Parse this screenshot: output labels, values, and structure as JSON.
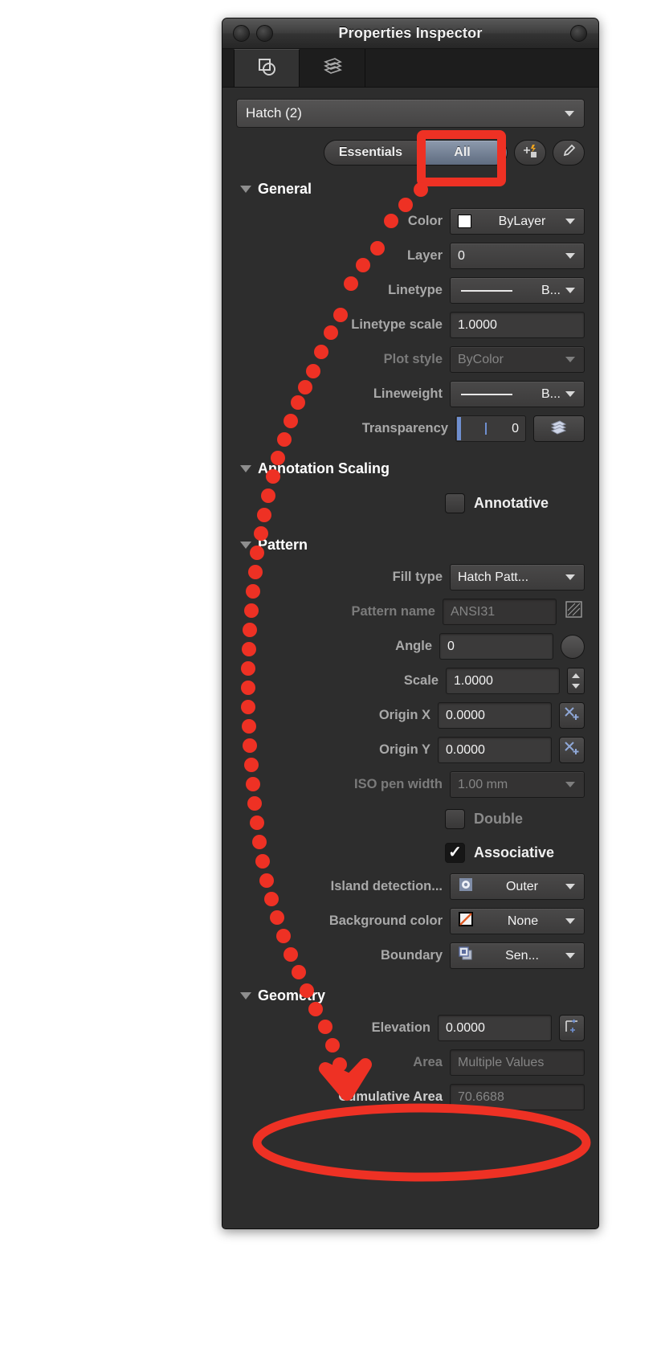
{
  "window": {
    "title": "Properties Inspector",
    "tabs": [
      {
        "name": "object-properties-tab",
        "icon": "overlapping-shapes-icon",
        "active": true
      },
      {
        "name": "layers-tab",
        "icon": "layers-stack-icon",
        "active": false
      }
    ]
  },
  "toolbar": {
    "object_selector": "Hatch (2)",
    "segmented": {
      "essentials_label": "Essentials",
      "all_label": "All",
      "selected": "All"
    },
    "quick_select_icon": "quick-select-wand-icon",
    "match_properties_icon": "eyedropper-icon"
  },
  "sections": [
    {
      "id": "general",
      "title": "General",
      "expanded": true,
      "rows": [
        {
          "label": "Color",
          "value": "ByLayer",
          "type": "dropdown",
          "swatch": "white",
          "disabled": false
        },
        {
          "label": "Layer",
          "value": "0",
          "type": "dropdown",
          "disabled": false
        },
        {
          "label": "Linetype",
          "value": "B...",
          "type": "dropdown",
          "linepreview": true,
          "disabled": false
        },
        {
          "label": "Linetype scale",
          "value": "1.0000",
          "type": "text",
          "disabled": false
        },
        {
          "label": "Plot style",
          "value": "ByColor",
          "type": "dropdown",
          "disabled": true
        },
        {
          "label": "Lineweight",
          "value": "B...",
          "type": "dropdown",
          "linepreview": true,
          "disabled": false
        },
        {
          "label": "Transparency",
          "value": "0",
          "type": "slider",
          "button_icon": "layers-stack-icon",
          "disabled": false
        }
      ]
    },
    {
      "id": "annotation-scaling",
      "title": "Annotation Scaling",
      "expanded": true,
      "checkboxes": [
        {
          "label": "Annotative",
          "checked": false,
          "disabled": false
        }
      ]
    },
    {
      "id": "pattern",
      "title": "Pattern",
      "expanded": true,
      "rows": [
        {
          "label": "Fill type",
          "value": "Hatch Patt...",
          "type": "dropdown",
          "disabled": false
        },
        {
          "label": "Pattern name",
          "value": "ANSI31",
          "type": "text",
          "disabled": true,
          "button_icon": "hatch-pattern-icon"
        },
        {
          "label": "Angle",
          "value": "0",
          "type": "text",
          "disabled": false,
          "button_icon": "angle-dial-icon"
        },
        {
          "label": "Scale",
          "value": "1.0000",
          "type": "text",
          "disabled": false,
          "button_icon": "stepper-icon"
        },
        {
          "label": "Origin X",
          "value": "0.0000",
          "type": "text",
          "disabled": false,
          "button_icon": "pick-point-icon"
        },
        {
          "label": "Origin Y",
          "value": "0.0000",
          "type": "text",
          "disabled": false,
          "button_icon": "pick-point-icon"
        },
        {
          "label": "ISO pen width",
          "value": "1.00 mm",
          "type": "dropdown",
          "disabled": true
        }
      ],
      "checkboxes": [
        {
          "label": "Double",
          "checked": false,
          "disabled": true
        },
        {
          "label": "Associative",
          "checked": true,
          "disabled": false
        }
      ],
      "rows2": [
        {
          "label": "Island detection...",
          "value": "Outer",
          "type": "dropdown",
          "icon": "island-outer-icon",
          "disabled": false
        },
        {
          "label": "Background color",
          "value": "None",
          "type": "dropdown",
          "icon": "no-color-swatch-icon",
          "disabled": false
        },
        {
          "label": "Boundary",
          "value": "Sen...",
          "type": "dropdown",
          "icon": "boundary-objects-icon",
          "disabled": false
        }
      ]
    },
    {
      "id": "geometry",
      "title": "Geometry",
      "expanded": true,
      "rows": [
        {
          "label": "Elevation",
          "value": "0.0000",
          "type": "text",
          "disabled": false,
          "button_icon": "elevation-pick-icon"
        },
        {
          "label": "Area",
          "value": "Multiple Values",
          "type": "text",
          "disabled": true
        },
        {
          "label": "Cumulative Area",
          "value": "70.6688",
          "type": "text",
          "disabled": true
        }
      ]
    }
  ],
  "annotations": {
    "highlight_color": "#ee3124",
    "rect_target": "All",
    "ellipse_target": "Cumulative Area",
    "arrow_target": "Elevation",
    "dotted_path_label": "dotted-trail-from-All-to-Elevation"
  }
}
